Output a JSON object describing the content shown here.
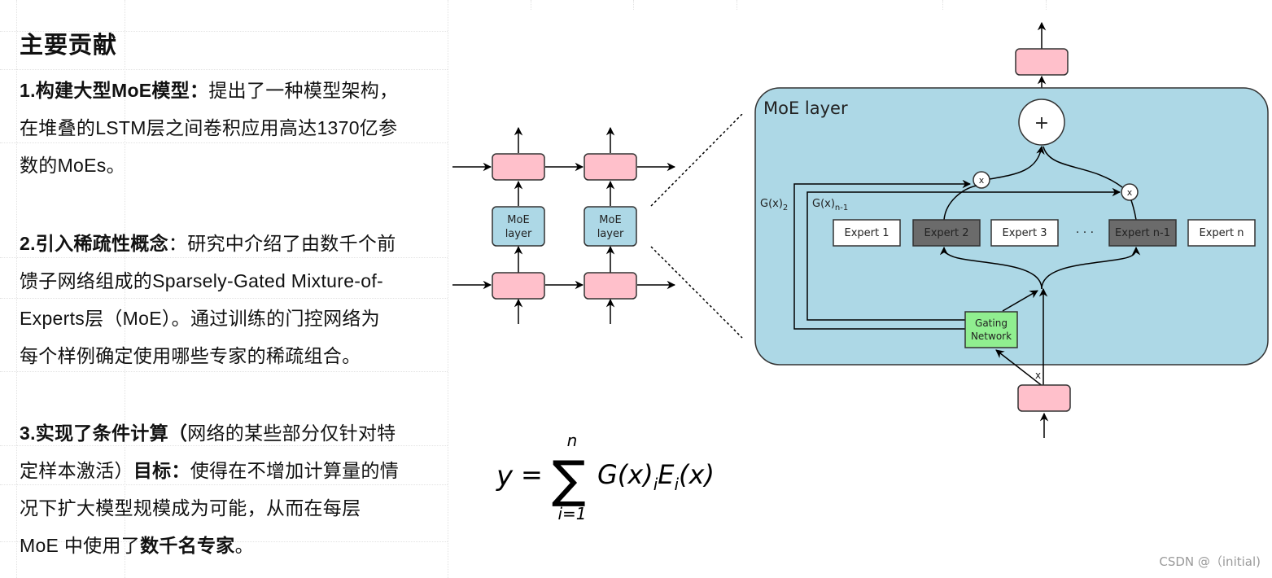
{
  "left_panel": {
    "title": "主要贡献",
    "items": [
      {
        "lines": [
          [
            {
              "t": "1.构建大型MoE模型：",
              "b": true
            },
            {
              "t": "提出了一种模型架构，",
              "b": false
            }
          ],
          [
            {
              "t": "在堆叠的LSTM层之间卷积应用高达1370亿参",
              "b": false
            }
          ],
          [
            {
              "t": "数的MoEs。",
              "b": false
            }
          ]
        ]
      },
      {
        "lines": [
          [
            {
              "t": "2.引入稀疏性概念",
              "b": true
            },
            {
              "t": "：研究中介绍了由数千个前",
              "b": false
            }
          ],
          [
            {
              "t": "馈子网络组成的Sparsely-Gated Mixture-of-",
              "b": false
            }
          ],
          [
            {
              "t": "Experts层（MoE）。通过训练的门控网络为",
              "b": false
            }
          ],
          [
            {
              "t": "每个样例确定使用哪些专家的稀疏组合。",
              "b": false
            }
          ]
        ]
      },
      {
        "lines": [
          [
            {
              "t": "3.实现了条件计算（",
              "b": true
            },
            {
              "t": "网络的某些部分仅针对特",
              "b": false
            }
          ],
          [
            {
              "t": "定样本激活）",
              "b": false
            },
            {
              "t": "目标：",
              "b": true
            },
            {
              "t": "使得在不增加计算量的情",
              "b": false
            }
          ],
          [
            {
              "t": "况下扩大模型规模成为可能，从而在每层",
              "b": false
            }
          ],
          [
            {
              "t": "MoE 中使用了",
              "b": false
            },
            {
              "t": "数千名专家",
              "b": true
            },
            {
              "t": "。",
              "b": false
            }
          ]
        ]
      }
    ]
  },
  "small_diagram": {
    "moe_label_line1": "MoE",
    "moe_label_line2": "layer"
  },
  "moe_diagram": {
    "title": "MoE layer",
    "plus_symbol": "+",
    "mult_symbol": "x",
    "gate_label_2": "G(x)",
    "gate_sub_2": "2",
    "gate_label_n1": "G(x)",
    "gate_sub_n1": "n-1",
    "experts": [
      {
        "label": "Expert 1",
        "active": false
      },
      {
        "label": "Expert 2",
        "active": true
      },
      {
        "label": "Expert 3",
        "active": false
      },
      {
        "label": "Expert n-1",
        "active": true
      },
      {
        "label": "Expert n",
        "active": false
      }
    ],
    "ellipsis": "· · ·",
    "gating_line1": "Gating",
    "gating_line2": "Network",
    "input_label": "x"
  },
  "formula": {
    "lhs": "y",
    "equals": "=",
    "sum_top": "n",
    "sum_bottom": "i=1",
    "rhs_G": "G(x)",
    "rhs_i1": "i",
    "rhs_E": "E",
    "rhs_i2": "i",
    "rhs_x": "(x)"
  },
  "colors": {
    "pink": "#ffc0cb",
    "moe_blue": "#add8e6",
    "gating_green": "#90ee90",
    "expert_active": "#6b6b6b",
    "expert_inactive": "#ffffff"
  },
  "watermark": "CSDN @（initial)"
}
